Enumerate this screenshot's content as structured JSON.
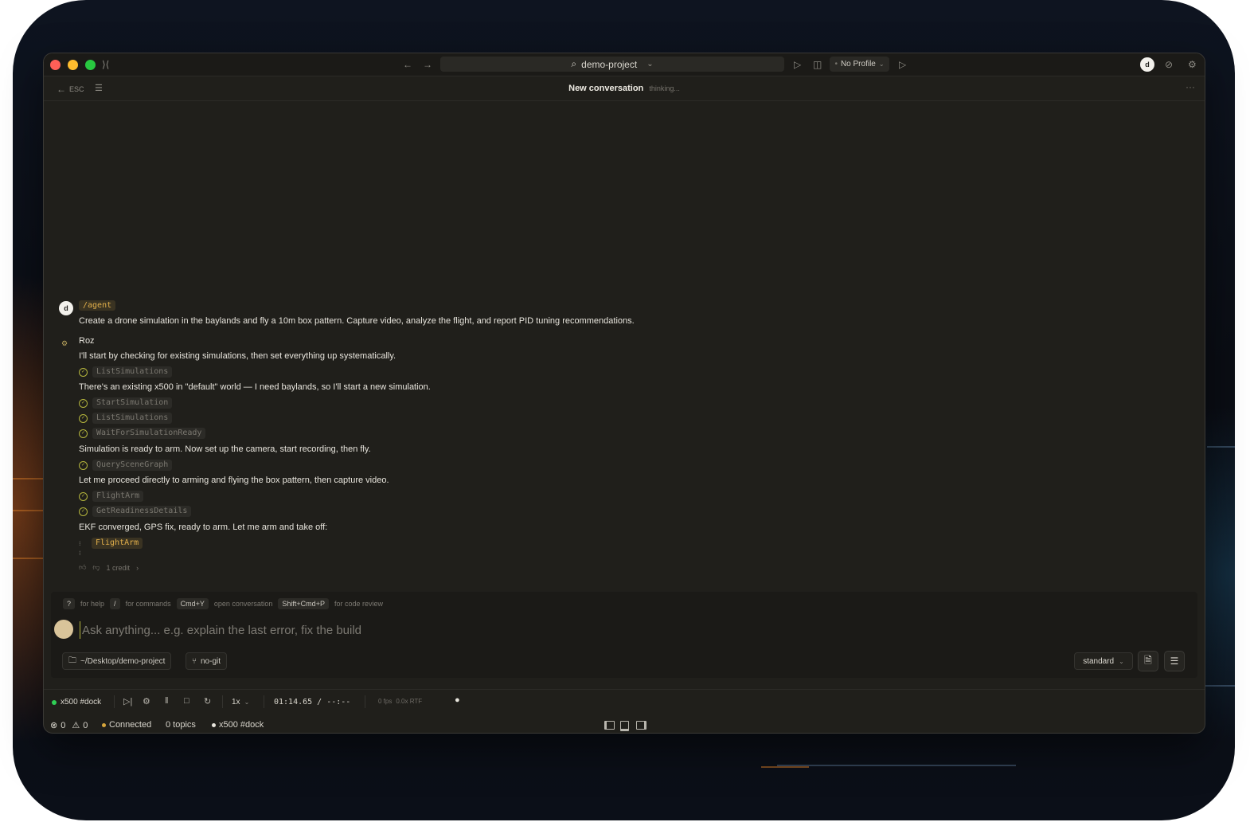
{
  "titlebar": {
    "search_text": "demo-project",
    "profile_label": "No Profile",
    "avatar_initial": "d"
  },
  "subbar": {
    "back_label": "ESC",
    "title": "New conversation",
    "status": "thinking..."
  },
  "chat": {
    "user_initial": "d",
    "command": "/agent",
    "user_message": "Create a drone simulation in the baylands and fly a 10m box pattern. Capture video, analyze the flight, and report PID tuning recommendations.",
    "agent_name": "Roz",
    "lines": [
      "I'll start by checking for existing simulations, then set everything up systematically.",
      "There's an existing x500 in \"default\" world — I need baylands, so I'll start a new simulation.",
      "Simulation is ready to arm. Now set up the camera, start recording, then fly.",
      "Let me proceed directly to arming and flying the box pattern, then capture video.",
      "EKF converged, GPS fix, ready to arm. Let me arm and take off:"
    ],
    "tools": [
      "ListSimulations",
      "StartSimulation",
      "ListSimulations",
      "WaitForSimulationReady",
      "QuerySceneGraph",
      "FlightArm",
      "GetReadinessDetails",
      "FlightArm"
    ],
    "credit": "1 credit"
  },
  "composer": {
    "hints": [
      {
        "key": "?",
        "text": "for help"
      },
      {
        "key": "/",
        "text": "for commands"
      },
      {
        "key": "Cmd+Y",
        "text": "open conversation"
      },
      {
        "key": "Shift+Cmd+P",
        "text": "for code review"
      }
    ],
    "placeholder": "Ask anything... e.g. explain the last error, fix the build",
    "folder": "~/Desktop/demo-project",
    "git": "no-git",
    "mode": "standard"
  },
  "simbar": {
    "vehicle": "x500 #dock",
    "speed": "1x",
    "time": "01:14.65 / --:--",
    "fps": "0 fps",
    "rtf": "0.0x RTF"
  },
  "statusbar": {
    "errors": "0",
    "warnings": "0",
    "connection": "Connected",
    "topics": "0 topics",
    "vehicle": "x500 #dock"
  },
  "colors": {
    "window_bg": "#201f1b",
    "accent_yellow": "#e3b04b",
    "check_green": "#b4b53d",
    "online_green": "#2fcf55"
  }
}
